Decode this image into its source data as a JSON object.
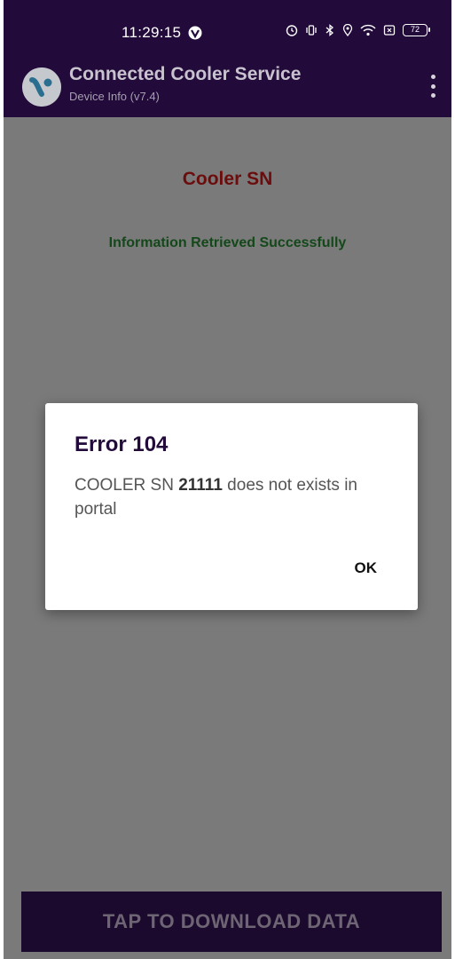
{
  "status_bar": {
    "time": "11:29:15",
    "battery": "72",
    "icons": [
      "vpn-icon",
      "alarm-icon",
      "vibrate-icon",
      "bluetooth-icon",
      "location-icon",
      "wifi-icon",
      "sim-icon",
      "battery-icon"
    ]
  },
  "app_bar": {
    "title": "Connected Cooler Service",
    "subtitle": "Device Info (v7.4)",
    "menu_icon": "overflow-menu-icon"
  },
  "content": {
    "cooler_title": "Cooler SN",
    "info_message": "Information Retrieved Successfully"
  },
  "dialog": {
    "title": "Error 104",
    "message_prefix": "COOLER SN ",
    "serial": "21111",
    "message_suffix": " does not exists in portal",
    "ok_label": "OK"
  },
  "bottom": {
    "download_label": "TAP TO DOWNLOAD DATA"
  },
  "colors": {
    "app_bar": "#220a3a",
    "scrim": "#7a7a7a",
    "cooler_title": "#6b0d0d",
    "info_message": "#14481a"
  }
}
